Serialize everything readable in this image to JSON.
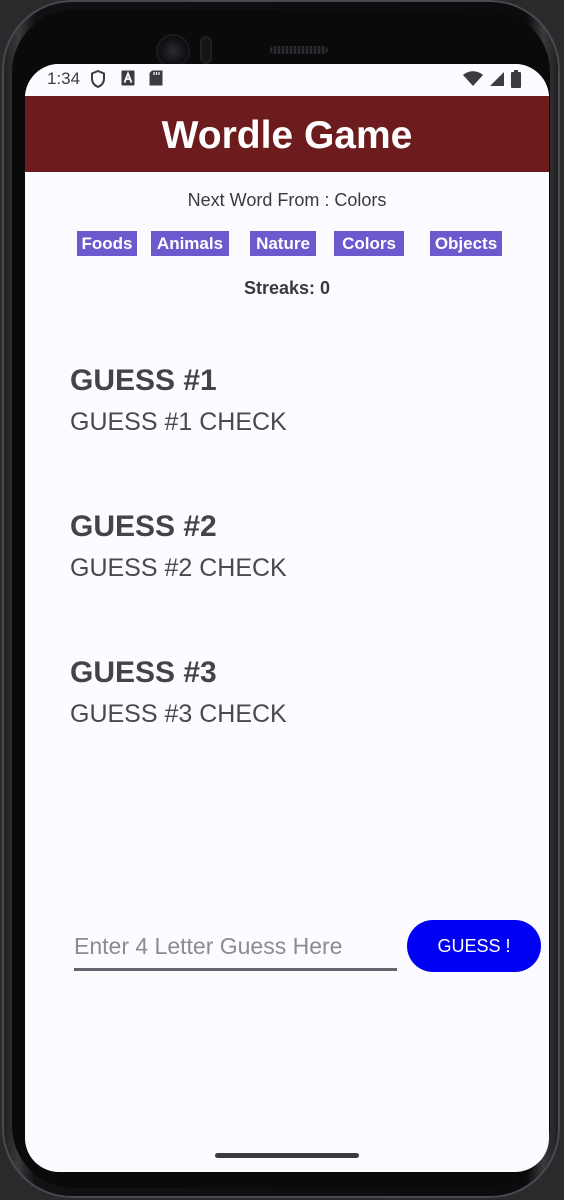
{
  "status_bar": {
    "time": "1:34"
  },
  "header": {
    "title": "Wordle Game"
  },
  "next_word": "Next Word From : Colors",
  "categories": [
    "Foods",
    "Animals",
    "Nature",
    "Colors",
    "Objects"
  ],
  "streaks": "Streaks: 0",
  "guesses": [
    {
      "title": "GUESS #1",
      "check": "GUESS #1 CHECK"
    },
    {
      "title": "GUESS #2",
      "check": "GUESS #2 CHECK"
    },
    {
      "title": "GUESS #3",
      "check": "GUESS #3 CHECK"
    }
  ],
  "input": {
    "placeholder": "Enter 4 Letter Guess Here",
    "value": ""
  },
  "guess_button": "GUESS !",
  "colors": {
    "header_bg": "#6d1c1d",
    "category_bg": "#6a5acd",
    "button_bg": "#0000f5",
    "screen_bg": "#fcfbff"
  }
}
